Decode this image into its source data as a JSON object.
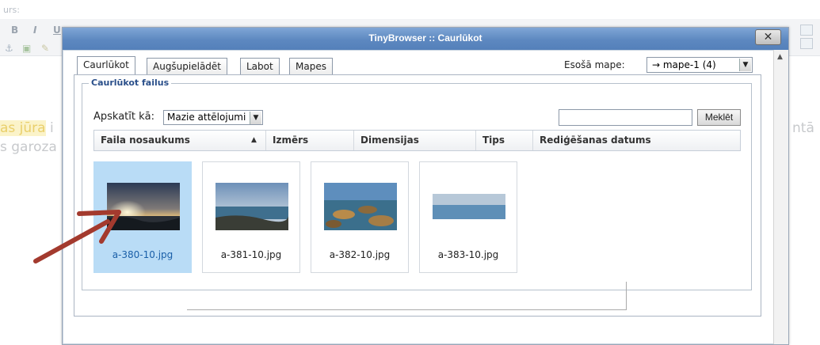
{
  "background": {
    "label": "urs:",
    "toolbar_buttons": [
      "B",
      "I",
      "U"
    ],
    "text_line1_highlight": "as jūra",
    "text_line1_tail": "i",
    "text_line2": "s garoza",
    "right_text": "ntā"
  },
  "window": {
    "title": "TinyBrowser :: Caurlūkot",
    "close_label": "✕"
  },
  "tabs": [
    {
      "label": "Caurlūkot",
      "active": true
    },
    {
      "label": "Augšupielādēt",
      "active": false
    },
    {
      "label": "Labot",
      "active": false
    },
    {
      "label": "Mapes",
      "active": false
    }
  ],
  "folder": {
    "label": "Esošā mape:",
    "value": "→ mape-1 (4)"
  },
  "browse": {
    "legend": "Caurlūkot failus",
    "view_label": "Apskatīt kā:",
    "view_value": "Mazie attēlojumi",
    "search_value": "",
    "search_button": "Meklēt"
  },
  "columns": {
    "name": "Faila nosaukums",
    "size": "Izmērs",
    "dimensions": "Dimensijas",
    "type": "Tips",
    "date": "Rediģēšanas datums"
  },
  "files": [
    {
      "name": "a-380-10.jpg",
      "selected": true
    },
    {
      "name": "a-381-10.jpg",
      "selected": false
    },
    {
      "name": "a-382-10.jpg",
      "selected": false
    },
    {
      "name": "a-383-10.jpg",
      "selected": false
    }
  ],
  "colors": {
    "titlebar": "#5d88c0",
    "selected_thumb": "#b9dcf6",
    "annotation_arrow": "#a33a2e"
  }
}
